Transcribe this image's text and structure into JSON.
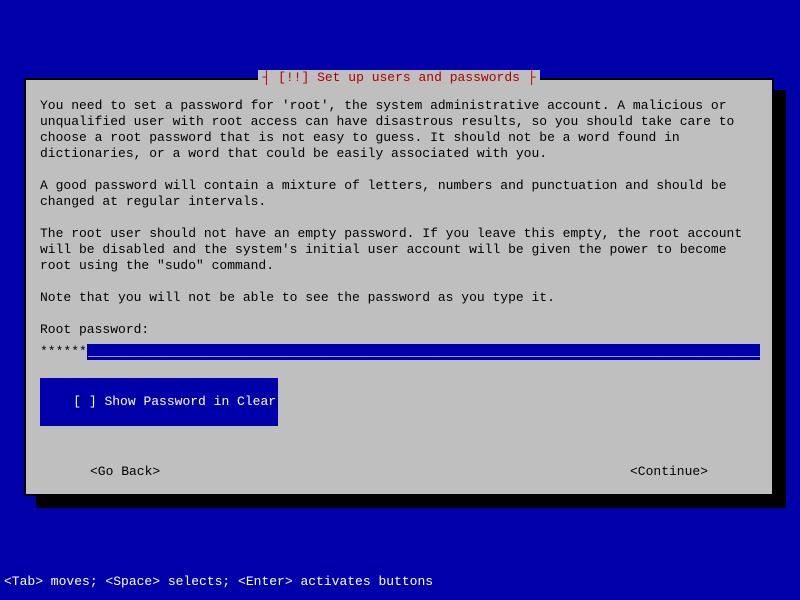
{
  "title": {
    "label": "[!!] Set up users and passwords",
    "decoration_left": "┤ ",
    "decoration_right": " ├"
  },
  "body": {
    "p1": "You need to set a password for 'root', the system administrative account. A malicious or unqualified user with root access can have disastrous results, so you should take care to choose a root password that is not easy to guess. It should not be a word found in dictionaries, or a word that could be easily associated with you.",
    "p2": "A good password will contain a mixture of letters, numbers and punctuation and should be changed at regular intervals.",
    "p3": "The root user should not have an empty password. If you leave this empty, the root account will be disabled and the system's initial user account will be given the power to become root using the \"sudo\" command.",
    "p4": "Note that you will not be able to see the password as you type it."
  },
  "prompt": {
    "label": "Root password:"
  },
  "password_field": {
    "masked_value": "******",
    "underline_fill": "_______________________________________________________________________________________"
  },
  "checkbox": {
    "state": "[ ]",
    "label": "Show Password in Clear"
  },
  "nav": {
    "back": "<Go Back>",
    "continue": "<Continue>"
  },
  "hint": "<Tab> moves; <Space> selects; <Enter> activates buttons"
}
